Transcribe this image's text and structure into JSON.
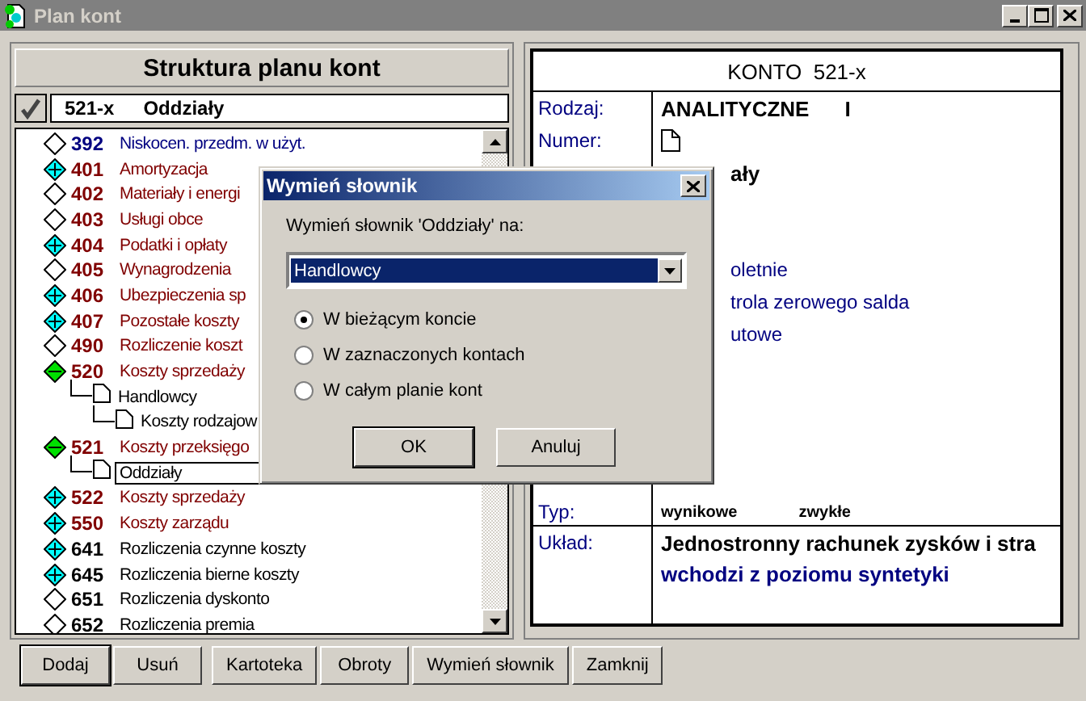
{
  "window": {
    "title": "Plan kont"
  },
  "tree_panel": {
    "title": "Struktura planu kont",
    "current_account": {
      "number": "521-x",
      "name": "Oddziały"
    },
    "accounts": [
      {
        "number": "392",
        "name": "Niskocen. przedm. w użyt.",
        "color": "#000080",
        "kind": "leaf"
      },
      {
        "number": "401",
        "name": "Amortyzacja",
        "color": "#800000",
        "kind": "collapsed"
      },
      {
        "number": "402",
        "name": "Materiały i energi",
        "color": "#800000",
        "kind": "leaf"
      },
      {
        "number": "403",
        "name": "Usługi obce",
        "color": "#800000",
        "kind": "leaf"
      },
      {
        "number": "404",
        "name": "Podatki i opłaty",
        "color": "#800000",
        "kind": "collapsed"
      },
      {
        "number": "405",
        "name": "Wynagrodzenia",
        "color": "#800000",
        "kind": "leaf"
      },
      {
        "number": "406",
        "name": "Ubezpieczenia sp",
        "color": "#800000",
        "kind": "collapsed"
      },
      {
        "number": "407",
        "name": "Pozostałe koszty",
        "color": "#800000",
        "kind": "collapsed"
      },
      {
        "number": "490",
        "name": "Rozliczenie koszt",
        "color": "#800000",
        "kind": "leaf"
      },
      {
        "number": "520",
        "name": "Koszty sprzedaży",
        "color": "#800000",
        "kind": "expanded",
        "children": [
          {
            "name": "Handlowcy",
            "selected": false,
            "children": [
              {
                "name": "Koszty rodzajow",
                "selected": false
              }
            ]
          }
        ]
      },
      {
        "number": "521",
        "name": "Koszty przeksięgo",
        "color": "#800000",
        "kind": "expanded",
        "children": [
          {
            "name": "Oddziały",
            "selected": true
          }
        ]
      },
      {
        "number": "522",
        "name": "Koszty sprzedaży",
        "color": "#800000",
        "kind": "collapsed"
      },
      {
        "number": "550",
        "name": "Koszty zarządu",
        "color": "#800000",
        "kind": "collapsed"
      },
      {
        "number": "641",
        "name": "Rozliczenia czynne koszty",
        "color": "#000000",
        "kind": "collapsed"
      },
      {
        "number": "645",
        "name": "Rozliczenia bierne koszty",
        "color": "#000000",
        "kind": "collapsed"
      },
      {
        "number": "651",
        "name": "Rozliczenia dyskonto",
        "color": "#000000",
        "kind": "leaf"
      },
      {
        "number": "652",
        "name": "Rozliczenia premia",
        "color": "#000000",
        "kind": "leaf"
      }
    ]
  },
  "account_card": {
    "title": "KONTO  521-x",
    "details": [
      {
        "kind": "text",
        "label": "Rodzaj:",
        "value": "ANALITYCZNE",
        "extra": "I"
      },
      {
        "kind": "icon",
        "label": "Numer:"
      },
      {
        "kind": "covered",
        "value": "ały",
        "bold": true
      },
      {
        "kind": "blank"
      },
      {
        "kind": "blank"
      },
      {
        "kind": "covered",
        "value": "oletnie",
        "bold": false
      },
      {
        "kind": "covered",
        "value": "trola zerowego salda",
        "bold": false
      },
      {
        "kind": "covered",
        "value": "utowe",
        "bold": false
      }
    ],
    "type": {
      "label": "Typ:",
      "values": [
        "wynikowe",
        "zwykłe"
      ]
    },
    "layout": {
      "label": "Układ:",
      "lines": [
        "Jednostronny rachunek zysków i stra",
        "wchodzi z poziomu syntetyki"
      ]
    }
  },
  "buttons": [
    {
      "label": "Dodaj",
      "default": true
    },
    {
      "label": "Usuń",
      "default": false
    },
    {
      "label": "Kartoteka",
      "default": false
    },
    {
      "label": "Obroty",
      "default": false
    },
    {
      "label": "Wymień słownik",
      "default": false
    },
    {
      "label": "Zamknij",
      "default": false
    }
  ],
  "dialog": {
    "title": "Wymień słownik",
    "prompt": "Wymień słownik 'Oddziały' na:",
    "combo_value": "Handlowcy",
    "options": [
      {
        "label": "W bieżącym koncie",
        "selected": true
      },
      {
        "label": "W zaznaczonych kontach",
        "selected": false
      },
      {
        "label": "W całym planie kont",
        "selected": false
      }
    ],
    "buttons": [
      {
        "label": "OK",
        "default": true
      },
      {
        "label": "Anuluj",
        "default": false
      }
    ]
  }
}
